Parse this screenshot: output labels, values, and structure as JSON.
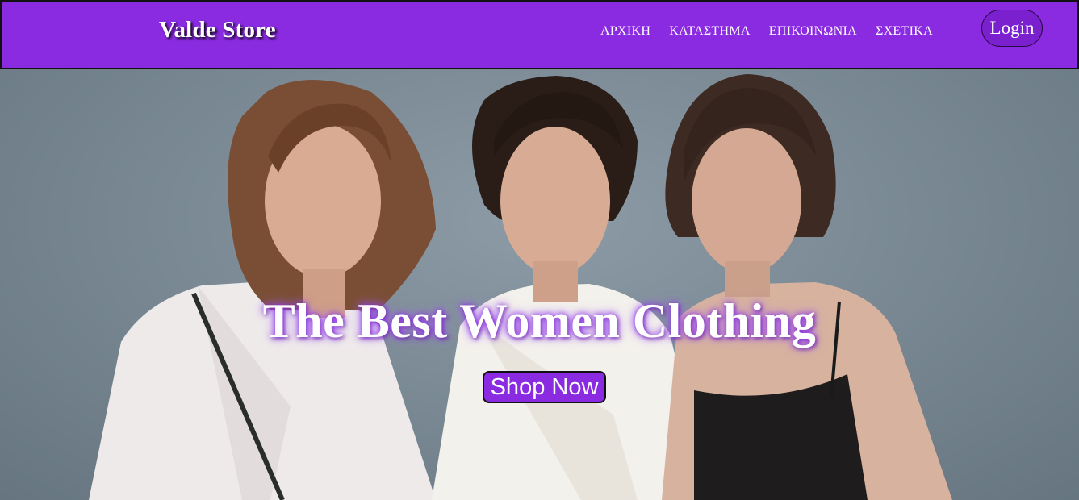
{
  "header": {
    "brand": "Valde Store",
    "nav": [
      {
        "label": "ΑΡΧΙΚΗ"
      },
      {
        "label": "ΚΑΤΑΣΤΗΜΑ"
      },
      {
        "label": "ΕΠΙΚΟΙΝΩΝΙΑ"
      },
      {
        "label": "ΣΧΕΤΙΚΑ"
      }
    ],
    "login_label": "Login"
  },
  "hero": {
    "title": "The Best Women Clothing",
    "cta_label": "Shop Now"
  },
  "colors": {
    "accent": "#8a2be2",
    "text": "#ffffff"
  }
}
